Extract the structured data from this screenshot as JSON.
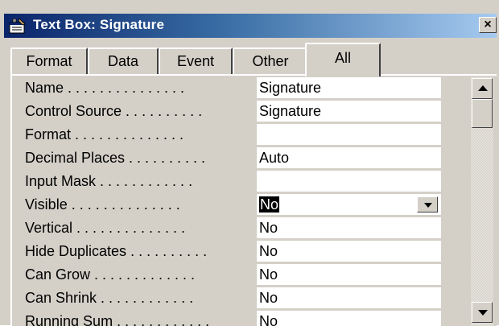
{
  "window": {
    "title": "Text Box: Signature",
    "close_label": "×"
  },
  "tabs": [
    {
      "label": "Format",
      "active": false
    },
    {
      "label": "Data",
      "active": false
    },
    {
      "label": "Event",
      "active": false
    },
    {
      "label": "Other",
      "active": false
    },
    {
      "label": "All",
      "active": true
    }
  ],
  "properties": [
    {
      "label": "Name . . . . . . . . . . . . . . .",
      "value": "Signature"
    },
    {
      "label": "Control Source . . . . . . . . . .",
      "value": "Signature"
    },
    {
      "label": "Format . . . . . . . . . . . . . .",
      "value": ""
    },
    {
      "label": "Decimal Places . . . . . . . . . .",
      "value": "Auto"
    },
    {
      "label": "Input Mask . . . . . . . . . . . .",
      "value": ""
    },
    {
      "label": "Visible . . . . . . . . . . . . . .",
      "value": "No",
      "selected": true,
      "dropdown": true
    },
    {
      "label": "Vertical . . . . . . . . . . . . . .",
      "value": "No"
    },
    {
      "label": "Hide Duplicates . . . . . . . . . .",
      "value": "No"
    },
    {
      "label": "Can Grow . . . . . . . . . . . . .",
      "value": "No"
    },
    {
      "label": "Can Shrink . . . . . . . . . . . .",
      "value": "No"
    },
    {
      "label": "Running Sum . . . . . . . . . . . .",
      "value": "No"
    }
  ],
  "icons": {
    "title": "properties-icon",
    "close": "close-icon",
    "dropdown": "chevron-down-icon",
    "scroll_up": "scroll-up-icon",
    "scroll_down": "scroll-down-icon"
  },
  "colors": {
    "titlebar_start": "#0a246a",
    "titlebar_end": "#a6caf0",
    "face": "#d4d0c8",
    "selection": "#000000"
  }
}
